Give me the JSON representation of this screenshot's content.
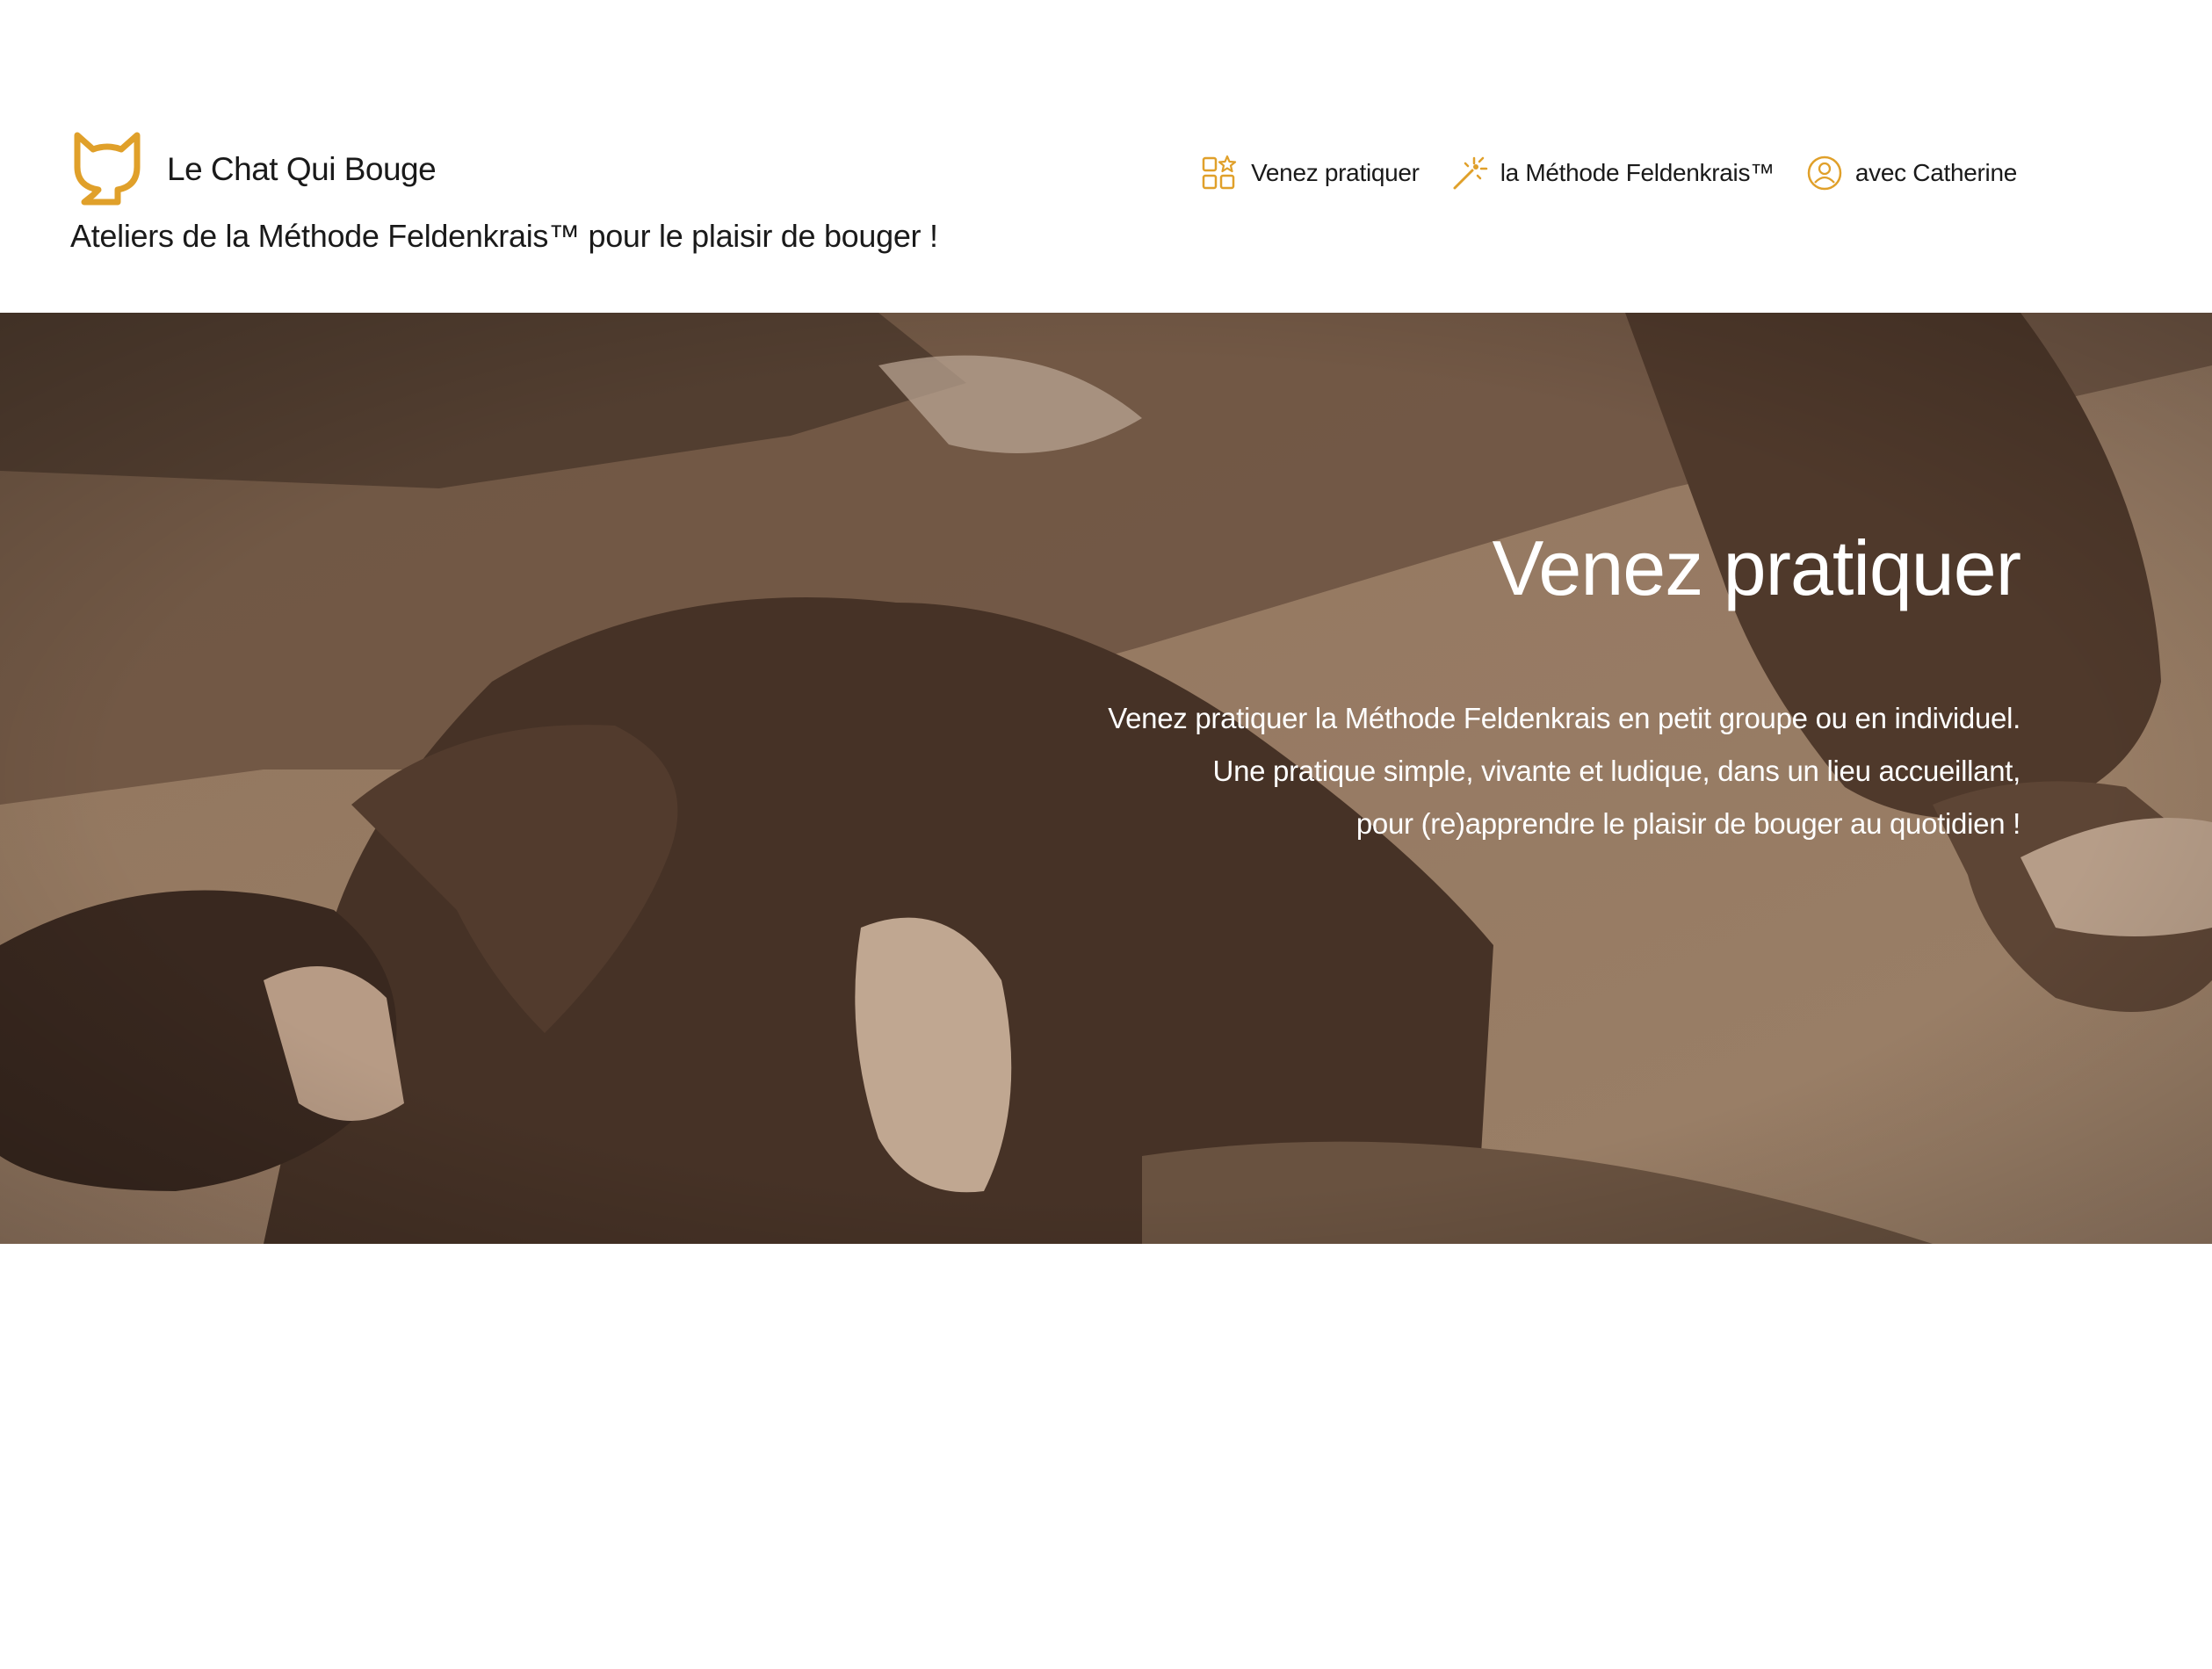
{
  "header": {
    "site_name": "Le Chat Qui Bouge",
    "tagline": "Ateliers de la Méthode Feldenkrais™ pour le plaisir de bouger !",
    "logo_icon": "cat-head-icon",
    "accent_color": "#e0a02a"
  },
  "nav": {
    "items": [
      {
        "label": "Venez pratiquer",
        "icon": "grid-star-icon"
      },
      {
        "label": "la Méthode Feldenkrais™",
        "icon": "magic-wand-icon"
      },
      {
        "label": "avec Catherine",
        "icon": "person-circle-icon"
      }
    ]
  },
  "hero": {
    "title": "Venez pratiquer",
    "lines": [
      "Venez pratiquer la Méthode Feldenkrais en petit groupe ou en individuel.",
      "Une pratique simple, vivante et ludique, dans un lieu accueillant,",
      "pour (re)apprendre le plaisir de bouger au quotidien !"
    ],
    "tint_color": "#8c6f58"
  }
}
